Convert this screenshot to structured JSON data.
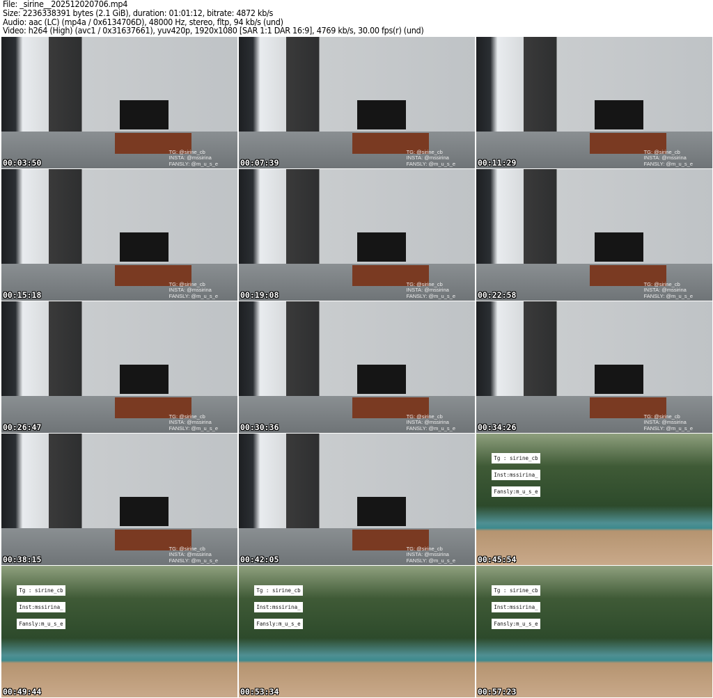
{
  "header": {
    "line1": "File: _sirine__202512020706.mp4",
    "line2": "Size: 2236338391 bytes (2.1 GiB), duration: 01:01:12, bitrate: 4872 kb/s",
    "line3": "Audio: aac (LC) (mp4a / 0x6134706D), 48000 Hz, stereo, fltp, 94 kb/s (und)",
    "line4": "Video: h264 (High) (avc1 / 0x31637661), yuv420p, 1920x1080 [SAR 1:1 DAR 16:9], 4769 kb/s, 30.00 fps(r) (und)"
  },
  "watermark_room": [
    "TG: @sirine_cb",
    "INSTA: @mssirina",
    "FANSLY: @m_u_s_e"
  ],
  "watermark_outdoor": [
    "Tg : sirine_cb",
    "Inst:mssirina_",
    "Fansly:m_u_s_e"
  ],
  "thumbnails": [
    {
      "time": "00:03:50",
      "scene": "room"
    },
    {
      "time": "00:07:39",
      "scene": "room"
    },
    {
      "time": "00:11:29",
      "scene": "room"
    },
    {
      "time": "00:15:18",
      "scene": "room"
    },
    {
      "time": "00:19:08",
      "scene": "room"
    },
    {
      "time": "00:22:58",
      "scene": "room"
    },
    {
      "time": "00:26:47",
      "scene": "room"
    },
    {
      "time": "00:30:36",
      "scene": "room"
    },
    {
      "time": "00:34:26",
      "scene": "room"
    },
    {
      "time": "00:38:15",
      "scene": "room"
    },
    {
      "time": "00:42:05",
      "scene": "room"
    },
    {
      "time": "00:45:54",
      "scene": "sea"
    },
    {
      "time": "00:49:44",
      "scene": "sea"
    },
    {
      "time": "00:53:34",
      "scene": "sea"
    },
    {
      "time": "00:57:23",
      "scene": "sea"
    }
  ]
}
